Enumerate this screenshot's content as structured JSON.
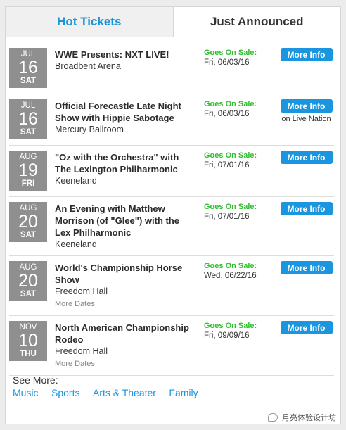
{
  "tabs": [
    {
      "label": "Hot Tickets"
    },
    {
      "label": "Just Announced"
    }
  ],
  "events": [
    {
      "month": "JUL",
      "day": "16",
      "weekday": "SAT",
      "title": "WWE Presents: NXT LIVE!",
      "venue": "Broadbent Arena",
      "more_dates": "",
      "sale_label": "Goes On Sale:",
      "sale_date": "Fri, 06/03/16",
      "button": "More Info",
      "note": ""
    },
    {
      "month": "JUL",
      "day": "16",
      "weekday": "SAT",
      "title": "Official Forecastle Late Night Show with Hippie Sabotage",
      "venue": "Mercury Ballroom",
      "more_dates": "",
      "sale_label": "Goes On Sale:",
      "sale_date": "Fri, 06/03/16",
      "button": "More Info",
      "note": "on Live Nation"
    },
    {
      "month": "AUG",
      "day": "19",
      "weekday": "FRI",
      "title": "\"Oz with the Orchestra\" with The Lexington Philharmonic",
      "venue": "Keeneland",
      "more_dates": "",
      "sale_label": "Goes On Sale:",
      "sale_date": "Fri, 07/01/16",
      "button": "More Info",
      "note": ""
    },
    {
      "month": "AUG",
      "day": "20",
      "weekday": "SAT",
      "title": "An Evening with Matthew Morrison (of \"Glee\") with the Lex Philharmonic",
      "venue": "Keeneland",
      "more_dates": "",
      "sale_label": "Goes On Sale:",
      "sale_date": "Fri, 07/01/16",
      "button": "More Info",
      "note": ""
    },
    {
      "month": "AUG",
      "day": "20",
      "weekday": "SAT",
      "title": "World's Championship Horse Show",
      "venue": "Freedom Hall",
      "more_dates": "More Dates",
      "sale_label": "Goes On Sale:",
      "sale_date": "Wed, 06/22/16",
      "button": "More Info",
      "note": ""
    },
    {
      "month": "NOV",
      "day": "10",
      "weekday": "THU",
      "title": "North American Championship Rodeo",
      "venue": "Freedom Hall",
      "more_dates": "More Dates",
      "sale_label": "Goes On Sale:",
      "sale_date": "Fri, 09/09/16",
      "button": "More Info",
      "note": ""
    }
  ],
  "see_more": {
    "label": "See More:",
    "links": [
      "Music",
      "Sports",
      "Arts & Theater",
      "Family"
    ]
  },
  "watermark": {
    "text": "月亮体验设计坊",
    "icon": "wechat-icon"
  },
  "colors": {
    "accent": "#1a95e0",
    "on_sale_green": "#2fbf2f",
    "date_block": "#8f8f8f"
  }
}
